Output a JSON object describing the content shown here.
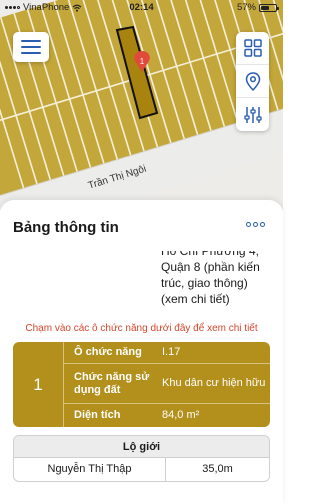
{
  "status_bar": {
    "carrier": "VinaPhone",
    "time": "02:14",
    "battery": "57%",
    "battery_level": 0.57
  },
  "map": {
    "street_label": "Trần Thị Ngôi",
    "marker_label": "1",
    "highlight_color": "#b38f1b"
  },
  "toolbar": {
    "menu_icon": "hamburger-icon",
    "layers_icon": "grid-icon",
    "location_icon": "location-pin-icon",
    "filter_icon": "sliders-icon"
  },
  "sheet": {
    "title": "Bảng thông tin",
    "more_icon": "more-icon",
    "address_cut": "Hồ Chí Phường 4,",
    "address_lines": [
      "Quận 8 (phần kiến",
      "trúc, giao thông)",
      "(xem chi tiết)"
    ],
    "hint": "Chạm vào các ô chức năng dưới đây để xem chi tiết",
    "lot": {
      "number": "1",
      "rows": [
        {
          "label": "Ô chức năng",
          "value": "I.17"
        },
        {
          "label": "Chức năng sử dụng đất",
          "value": "Khu dân cư hiện hữu"
        },
        {
          "label": "Diện tích",
          "value": "84,0 m²"
        }
      ]
    },
    "road_table": {
      "header": "Lộ giới",
      "rows": [
        {
          "name": "Nguyễn Thị Thập",
          "width": "35,0m"
        }
      ]
    }
  }
}
